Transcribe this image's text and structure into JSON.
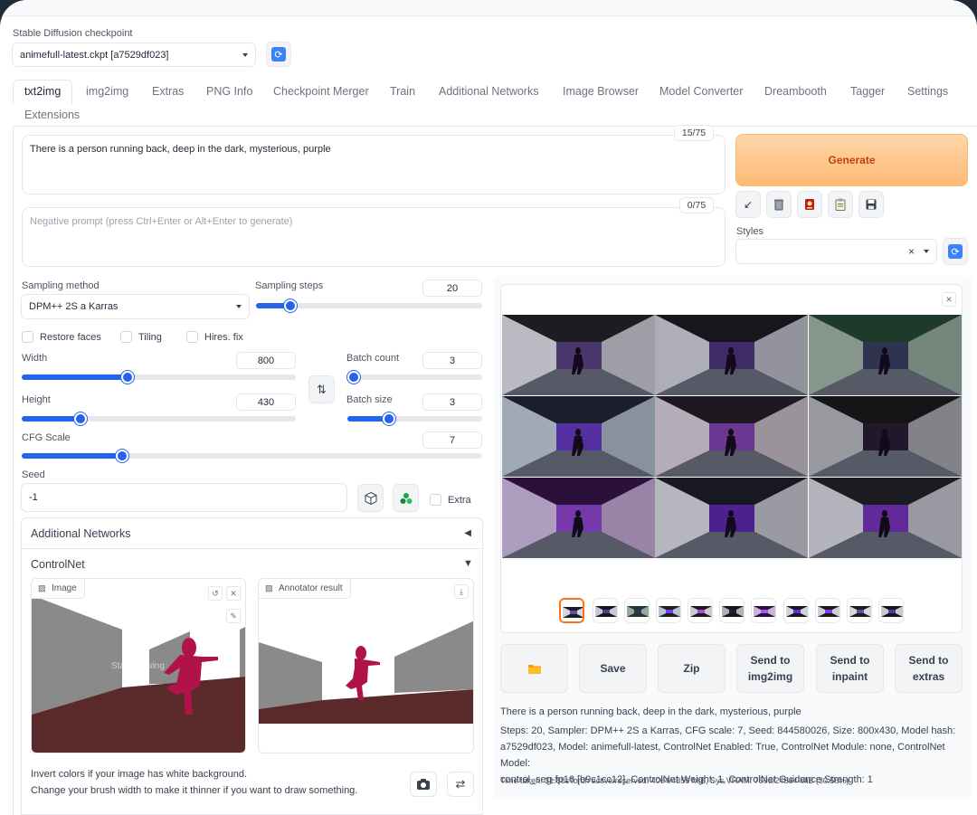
{
  "checkpoint": {
    "label": "Stable Diffusion checkpoint",
    "value": "animefull-latest.ckpt [a7529df023]"
  },
  "tabs": [
    "txt2img",
    "img2img",
    "Extras",
    "PNG Info",
    "Checkpoint Merger",
    "Train",
    "Additional Networks",
    "Image Browser",
    "Model Converter",
    "Dreambooth",
    "Tagger",
    "Settings",
    "Extensions"
  ],
  "prompt": {
    "value": "There is a person running back, deep in the dark, mysterious, purple",
    "counter": "15/75"
  },
  "negative": {
    "placeholder": "Negative prompt (press Ctrl+Enter or Alt+Enter to generate)",
    "counter": "0/75"
  },
  "generate": {
    "label": "Generate"
  },
  "styles": {
    "label": "Styles"
  },
  "sampling": {
    "method_label": "Sampling method",
    "method_value": "DPM++ 2S a Karras",
    "steps_label": "Sampling steps",
    "steps_value": "20",
    "steps_fraction": 0.13
  },
  "checks": {
    "restore": "Restore faces",
    "tiling": "Tiling",
    "hires": "Hires. fix"
  },
  "width": {
    "label": "Width",
    "value": "800",
    "fraction": 0.38
  },
  "height": {
    "label": "Height",
    "value": "430",
    "fraction": 0.2
  },
  "batch_count": {
    "label": "Batch count",
    "value": "3",
    "fraction": 0.0
  },
  "batch_size": {
    "label": "Batch size",
    "value": "3",
    "fraction": 0.29
  },
  "cfg": {
    "label": "CFG Scale",
    "value": "7",
    "fraction": 0.21
  },
  "seed": {
    "label": "Seed",
    "value": "-1",
    "extra": "Extra"
  },
  "additional_networks": {
    "label": "Additional Networks"
  },
  "controlnet": {
    "label": "ControlNet",
    "image_tag": "Image",
    "annotator_tag": "Annotator result",
    "start_drawing": "Start drawing",
    "note1": "Invert colors if your image has white background.",
    "note2": "Change your brush width to make it thinner if you want to draw something."
  },
  "actions": {
    "save": "Save",
    "zip": "Zip",
    "img2img_1": "Send to",
    "img2img_2": "img2img",
    "inpaint_1": "Send to",
    "inpaint_2": "inpaint",
    "extras_1": "Send to",
    "extras_2": "extras"
  },
  "output": {
    "prompt": "There is a person running back, deep in the dark, mysterious, purple",
    "params1": "Steps: 20, Sampler: DPM++ 2S a Karras, CFG scale: 7, Seed: 844580026, Size: 800x430, Model hash:",
    "params2": "a7529df023, Model: animefull-latest, ControlNet Enabled: True, ControlNet Module: none, ControlNet Model:",
    "params3": "control_seg-fp16 [b9c1cc12], ControlNet Weight: 1, ControlNet Guidance Strength: 1",
    "time": "Time taken: 31.88sTorch active/reserved: 4064/4856 MiB, Sys VRAM: 7506/24564 MiB (30.56%)"
  },
  "icons": {
    "refresh": "refresh-icon",
    "trash": "trash-icon",
    "folder": "folder-icon",
    "close": "close-icon",
    "swap": "swap-icon",
    "dice": "dice-icon",
    "recycle": "recycle-icon"
  }
}
